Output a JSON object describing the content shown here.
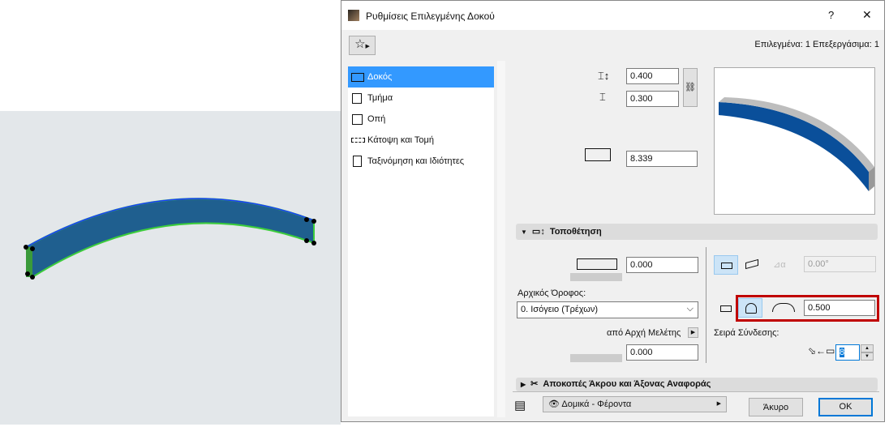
{
  "dialog": {
    "title": "Ρυθμίσεις Επιλεγμένης Δοκού",
    "help": "?",
    "close": "✕",
    "selection_info": "Επιλεγμένα: 1 Επεξεργάσιμα: 1"
  },
  "sidebar": {
    "items": [
      {
        "label": "Δοκός",
        "selected": true
      },
      {
        "label": "Τμήμα"
      },
      {
        "label": "Οπή"
      },
      {
        "label": "Κάτοψη και Τομή"
      },
      {
        "label": "Ταξινόμηση και Ιδιότητες"
      }
    ]
  },
  "dimensions": {
    "height": "0.400",
    "width": "0.300",
    "length": "8.339"
  },
  "placement": {
    "title": "Τοποθέτηση",
    "offset": "0.000",
    "home_story_label": "Αρχικός Όροφος:",
    "home_story_value": "0. Ισόγειο (Τρέχων)",
    "from_origin_label": "από Αρχή Μελέτης",
    "elevation": "0.000",
    "slant_angle": "0.00°",
    "curve_height": "0.500",
    "link_order_label": "Σειρά Σύνδεσης:",
    "link_order_value": "8"
  },
  "section2": {
    "title": "Αποκοπές Άκρου και Άξονας Αναφοράς"
  },
  "footer": {
    "layer": "Δομικά - Φέροντα",
    "cancel": "Άκυρο",
    "ok": "OK"
  },
  "colors": {
    "selected": "#3399ff",
    "beam": "#1f5f8f",
    "highlight": "#c00000"
  }
}
